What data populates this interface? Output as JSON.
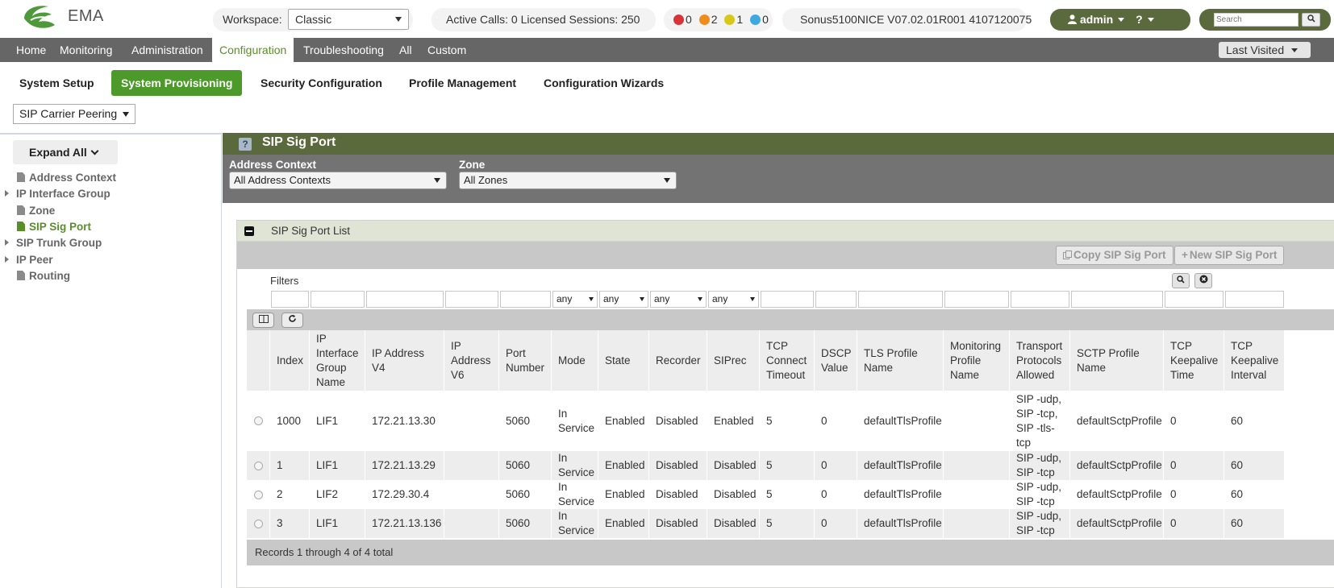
{
  "app": {
    "name": "EMA"
  },
  "header": {
    "workspace_label": "Workspace:",
    "workspace_value": "Classic",
    "calls_text": "Active Calls: 0 Licensed Sessions: 250",
    "alarms": [
      {
        "color": "#d9333a",
        "count": "0"
      },
      {
        "color": "#f08c1e",
        "count": "2"
      },
      {
        "color": "#d8c81c",
        "count": "1"
      },
      {
        "color": "#3fa8e0",
        "count": "0"
      }
    ],
    "version": "Sonus5100NICE V07.02.01R001 4107120075",
    "user": "admin",
    "help": "?",
    "search_placeholder": "Search"
  },
  "nav": {
    "items": [
      "Home",
      "Monitoring",
      "Administration",
      "Configuration",
      "Troubleshooting",
      "All",
      "Custom"
    ],
    "last_visited": "Last Visited"
  },
  "subnav": {
    "items": [
      "System Setup",
      "System Provisioning",
      "Security Configuration",
      "Profile Management",
      "Configuration Wizards"
    ],
    "select_value": "SIP Carrier Peering"
  },
  "sidebar": {
    "expand_all": "Expand All",
    "items": [
      {
        "label": "Address Context",
        "type": "file"
      },
      {
        "label": "IP Interface Group",
        "type": "folder"
      },
      {
        "label": "Zone",
        "type": "file"
      },
      {
        "label": "SIP Sig Port",
        "type": "file",
        "selected": true
      },
      {
        "label": "SIP Trunk Group",
        "type": "folder"
      },
      {
        "label": "IP Peer",
        "type": "folder"
      },
      {
        "label": "Routing",
        "type": "file"
      }
    ]
  },
  "page": {
    "title": "SIP Sig Port",
    "help_icon": "?"
  },
  "filters_top": {
    "address_context_label": "Address Context",
    "address_context_value": "All Address Contexts",
    "zone_label": "Zone",
    "zone_value": "All Zones"
  },
  "list": {
    "title": "SIP Sig Port List",
    "copy_button": "Copy SIP Sig Port",
    "new_button": "New SIP Sig Port",
    "filters_label": "Filters",
    "any": "any",
    "columns": [
      "Index",
      "IP Interface Group Name",
      "IP Address V4",
      "IP Address V6",
      "Port Number",
      "Mode",
      "State",
      "Recorder",
      "SIPrec",
      "TCP Connect Timeout",
      "DSCP Value",
      "TLS Profile Name",
      "Monitoring Profile Name",
      "Transport Protocols Allowed",
      "SCTP Profile Name",
      "TCP Keepalive Time",
      "TCP Keepalive Interval"
    ],
    "rows": [
      [
        "1000",
        "LIF1",
        "172.21.13.30",
        "",
        "5060",
        "In Service",
        "Enabled",
        "Disabled",
        "Enabled",
        "5",
        "0",
        "defaultTlsProfile",
        "",
        "SIP -udp, SIP -tcp, SIP -tls-tcp",
        "defaultSctpProfile",
        "0",
        "60"
      ],
      [
        "1",
        "LIF1",
        "172.21.13.29",
        "",
        "5060",
        "In Service",
        "Enabled",
        "Disabled",
        "Disabled",
        "5",
        "0",
        "defaultTlsProfile",
        "",
        "SIP -udp, SIP -tcp",
        "defaultSctpProfile",
        "0",
        "60"
      ],
      [
        "2",
        "LIF2",
        "172.29.30.4",
        "",
        "5060",
        "In Service",
        "Enabled",
        "Disabled",
        "Disabled",
        "5",
        "0",
        "defaultTlsProfile",
        "",
        "SIP -udp, SIP -tcp",
        "defaultSctpProfile",
        "0",
        "60"
      ],
      [
        "3",
        "LIF1",
        "172.21.13.136",
        "",
        "5060",
        "In Service",
        "Enabled",
        "Disabled",
        "Disabled",
        "5",
        "0",
        "defaultTlsProfile",
        "",
        "SIP -udp, SIP -tcp",
        "defaultSctpProfile",
        "0",
        "60"
      ]
    ],
    "footer": "Records 1 through 4 of 4 total"
  },
  "colors": {
    "olive": "#5b6a3c",
    "green_accent": "#4c9a2a",
    "nav_gray": "#666666"
  }
}
